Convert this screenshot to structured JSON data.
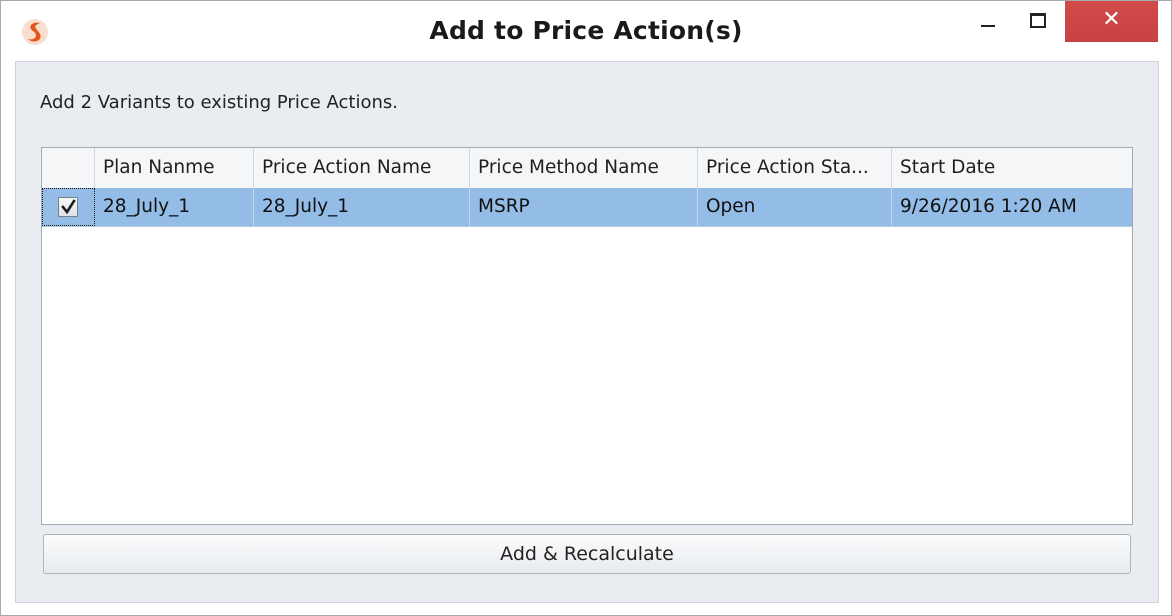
{
  "window": {
    "title": "Add to Price Action(s)",
    "close_glyph": "✕",
    "accent_close": "#c84949"
  },
  "icons": {
    "app": "app-logo-icon",
    "minimize": "minimize-icon",
    "maximize": "maximize-icon",
    "close": "close-icon",
    "check": "checkmark-icon"
  },
  "message": "Add 2 Variants to existing Price Actions.",
  "grid": {
    "columns": [
      "Plan Nanme",
      "Price Action Name",
      "Price Method Name",
      "Price Action Sta...",
      "Start Date"
    ],
    "rows": [
      {
        "checked": true,
        "cells": [
          "28_July_1",
          "28_July_1",
          "MSRP",
          "Open",
          "9/26/2016 1:20 AM"
        ]
      }
    ],
    "selected_row_color": "#93bce6"
  },
  "button": {
    "label": "Add & Recalculate"
  }
}
